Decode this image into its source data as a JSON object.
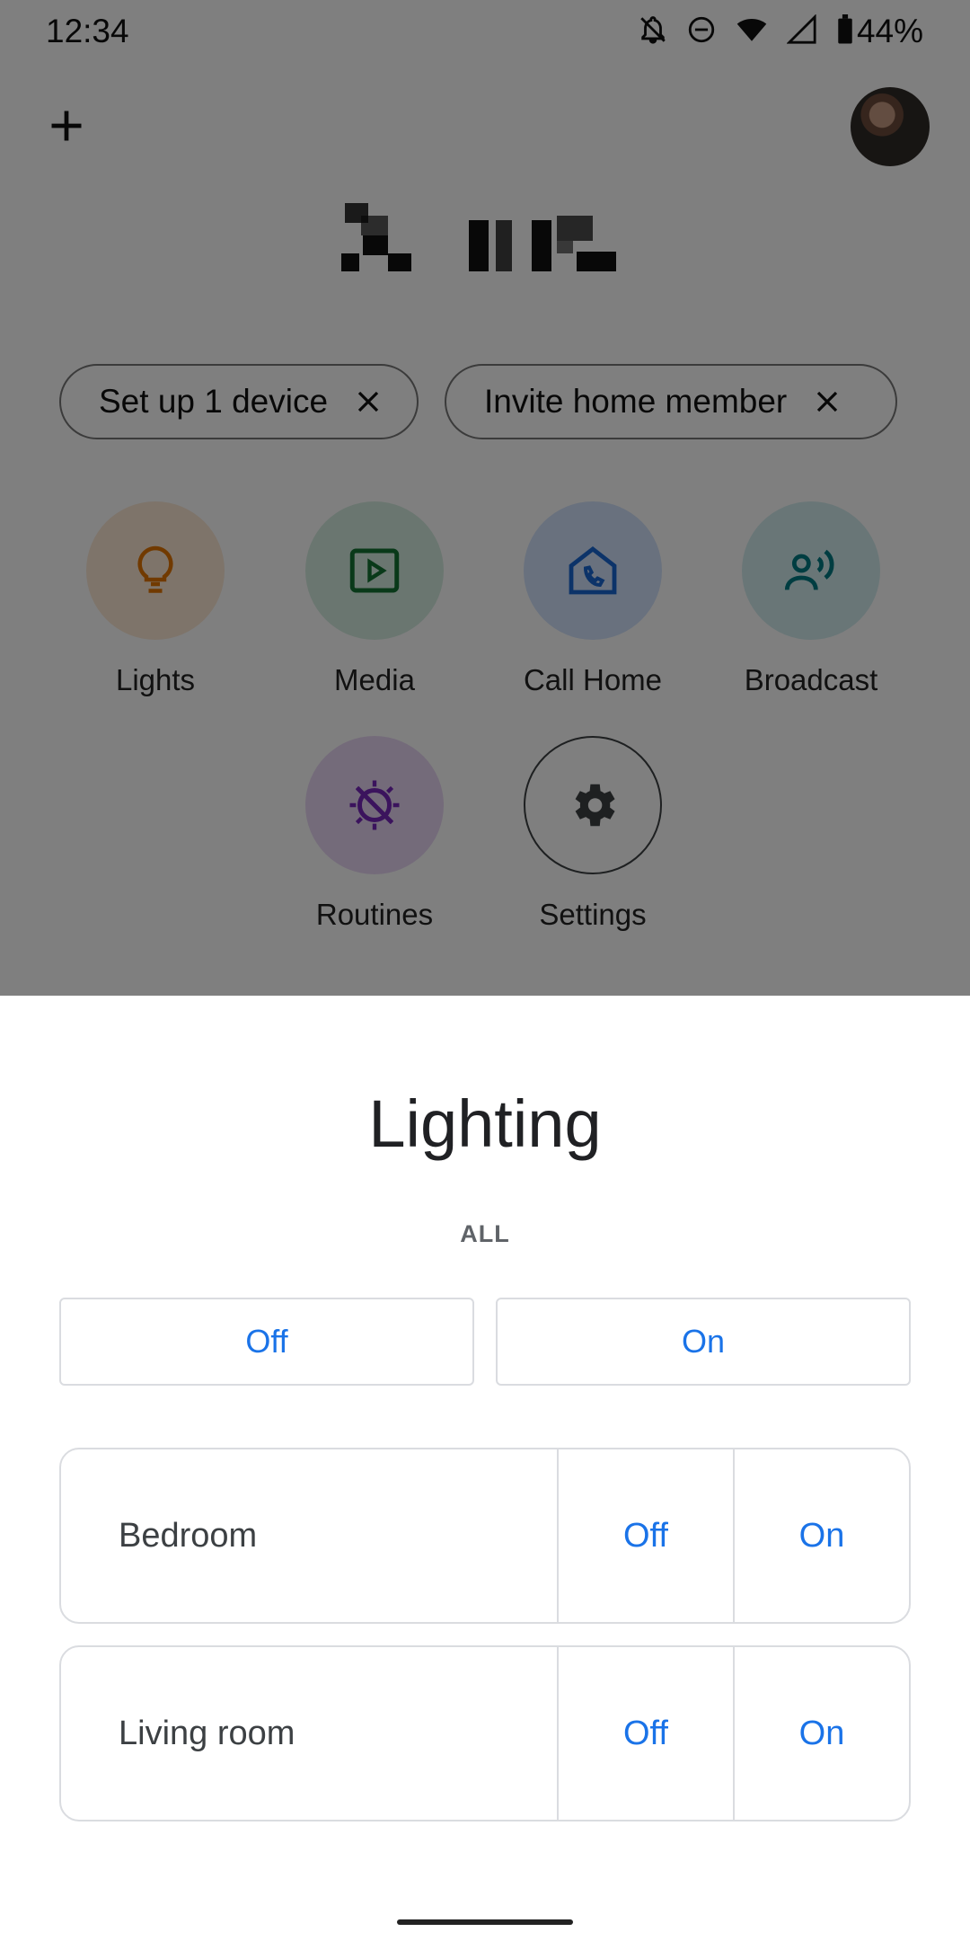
{
  "status_bar": {
    "time": "12:34",
    "battery": "44%",
    "icons": [
      "notifications-off-icon",
      "do-not-disturb-icon",
      "wifi-icon",
      "signal-icon",
      "battery-icon"
    ]
  },
  "header": {
    "add_icon": "plus-icon",
    "avatar": "profile-avatar"
  },
  "chips": [
    {
      "label": "Set up 1 device"
    },
    {
      "label": "Invite home member"
    }
  ],
  "actions": [
    {
      "label": "Lights",
      "icon": "lightbulb-icon",
      "color": "#e37400",
      "bg": "#fce8d5"
    },
    {
      "label": "Media",
      "icon": "play-icon",
      "color": "#137333",
      "bg": "#d5ece0"
    },
    {
      "label": "Call Home",
      "icon": "call-home-icon",
      "color": "#1967d2",
      "bg": "#d2e3fc"
    },
    {
      "label": "Broadcast",
      "icon": "broadcast-icon",
      "color": "#007b83",
      "bg": "#d3ecef"
    },
    {
      "label": "Routines",
      "icon": "routines-icon",
      "color": "#7627bb",
      "bg": "#e9d7f5"
    },
    {
      "label": "Settings",
      "icon": "gear-icon",
      "color": "#3c4043",
      "bg": "#ffffff"
    }
  ],
  "sheet": {
    "title": "Lighting",
    "subtitle": "ALL",
    "all_off": "Off",
    "all_on": "On",
    "rooms": [
      {
        "name": "Bedroom",
        "off": "Off",
        "on": "On"
      },
      {
        "name": "Living room",
        "off": "Off",
        "on": "On"
      }
    ]
  },
  "colors": {
    "accent": "#1a73e8",
    "scrim": "rgba(0,0,0,0.5)"
  }
}
